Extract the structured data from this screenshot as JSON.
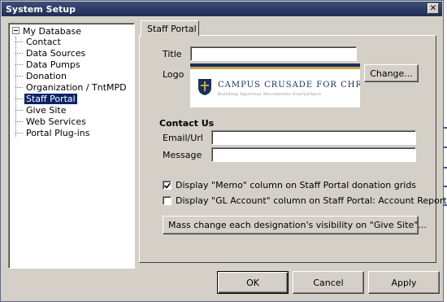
{
  "window": {
    "title": "System Setup",
    "close_glyph": "✕"
  },
  "tree": {
    "root": "My Database",
    "items": [
      {
        "label": "Contact"
      },
      {
        "label": "Data Sources"
      },
      {
        "label": "Data Pumps"
      },
      {
        "label": "Donation"
      },
      {
        "label": "Organization / TntMPD"
      },
      {
        "label": "Staff Portal",
        "selected": true
      },
      {
        "label": "Give Site"
      },
      {
        "label": "Web Services"
      },
      {
        "label": "Portal Plug-ins"
      }
    ]
  },
  "tab": {
    "label": "Staff Portal"
  },
  "form": {
    "title_label": "Title",
    "title_value": "",
    "logo_label": "Logo",
    "change_button": "Change...",
    "logo": {
      "org_name": "CAMPUS CRUSADE FOR CHRIST",
      "tagline": "Building Spiritual Movements Everywhere",
      "colors": {
        "navy": "#1a2f5c",
        "gold": "#c8a446"
      }
    },
    "contact_heading": "Contact Us",
    "email_label": "Email/Url",
    "email_value": "",
    "message_label": "Message",
    "message_value": "",
    "memo_checkbox": {
      "label": "Display \"Memo\" column on Staff Portal donation grids",
      "checked": true
    },
    "gl_checkbox": {
      "label": "Display \"GL Account\" column on Staff Portal: Account Report",
      "checked": false
    },
    "mass_change_button": "Mass change each designation's visibility on \"Give Site\"..."
  },
  "footer": {
    "ok": "OK",
    "cancel": "Cancel",
    "apply": "Apply"
  }
}
